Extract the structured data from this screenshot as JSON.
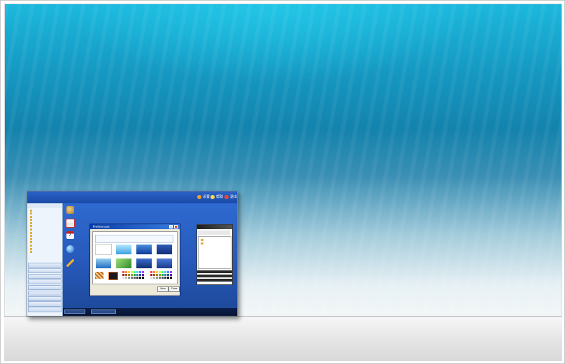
{
  "app": {
    "title": "",
    "header_links": [
      "设置",
      "帮助",
      "退出"
    ]
  },
  "sidebar": {
    "header": "",
    "tree": [
      "",
      "",
      "",
      "",
      "",
      "",
      "",
      "",
      "",
      "",
      "",
      "",
      "",
      ""
    ],
    "accordion": [
      "",
      "",
      "",
      "",
      "",
      "",
      "",
      "",
      "",
      "",
      ""
    ]
  },
  "desktop_icons": [
    "",
    "",
    "",
    ""
  ],
  "dialog": {
    "title": "Preferences",
    "ok": "Save",
    "cancel": "Close"
  },
  "panel": {
    "title": "",
    "sections": [
      "",
      "",
      ""
    ]
  },
  "taskbar": [
    "",
    ""
  ],
  "colors": {
    "header_bg": "#2a62c7",
    "desktop_bg": "#2658b8",
    "sidebar_bg": "#eef4fb",
    "accent": "#1cb8dd"
  }
}
